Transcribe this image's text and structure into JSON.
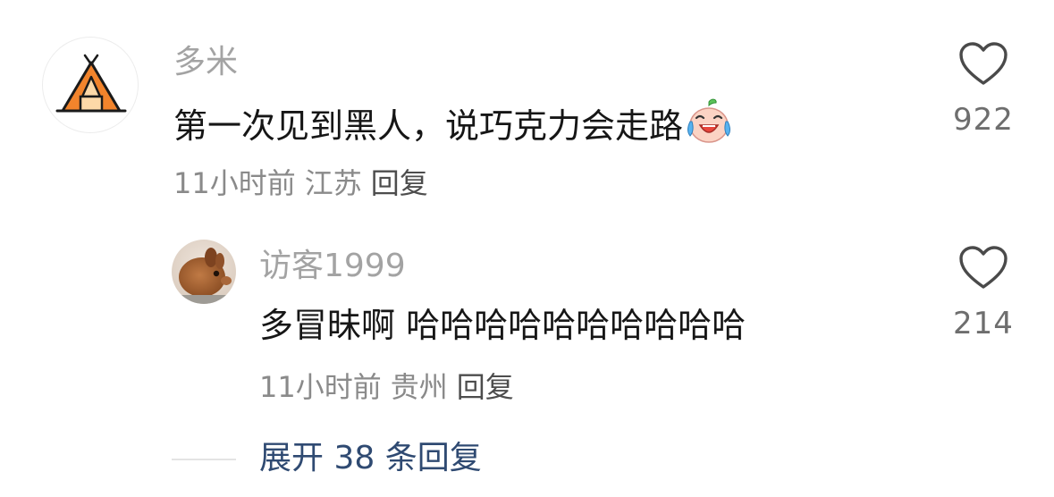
{
  "comment": {
    "username": "多米",
    "text": "第一次见到黑人，说巧克力会走路",
    "emoji": "laugh-cry-emoji",
    "time": "11小时前",
    "location": "江苏",
    "reply_label": "回复",
    "like_count": "922",
    "avatar_icon": "tent-icon"
  },
  "reply": {
    "username": "访客1999",
    "text": "多冒昧啊 哈哈哈哈哈哈哈哈哈哈",
    "time": "11小时前",
    "location": "贵州",
    "reply_label": "回复",
    "like_count": "214",
    "avatar_icon": "brown-animal-avatar"
  },
  "expand": {
    "label": "展开 38 条回复"
  },
  "colors": {
    "username": "#a3a3a3",
    "content": "#161616",
    "meta": "#8a8a8a",
    "link": "#2f4a72",
    "tent_orange": "#f2842c"
  }
}
